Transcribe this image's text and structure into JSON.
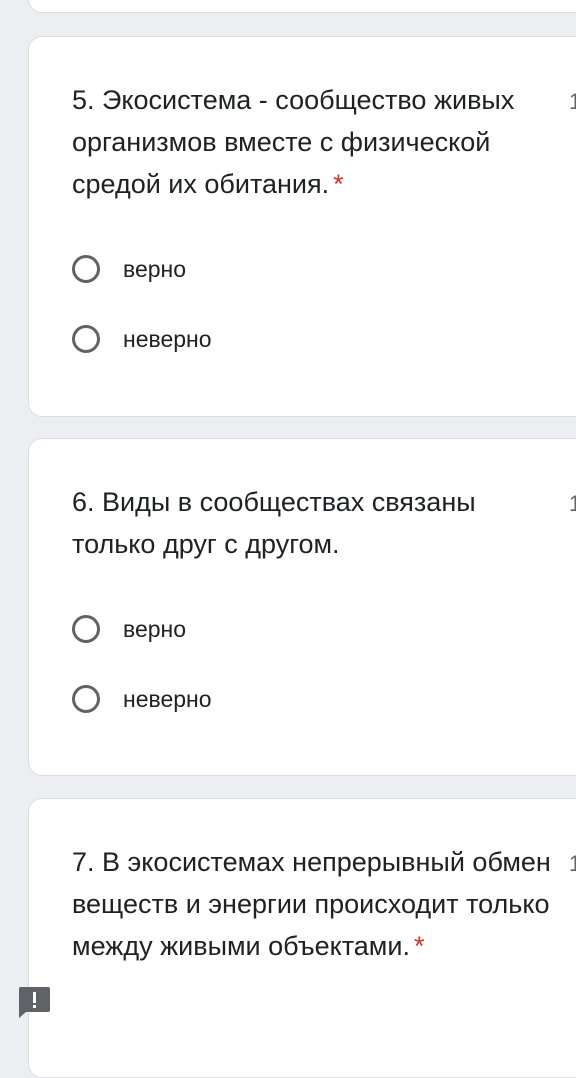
{
  "questions": [
    {
      "title": "5. Экосистема - сообщество живых организмов вместе с физической средой их обитания.",
      "required_mark": "*",
      "points": "1",
      "options": [
        "верно",
        "неверно"
      ]
    },
    {
      "title": "6. Виды в сообществах связаны только друг с другом.",
      "points": "1",
      "options": [
        "верно",
        "неверно"
      ]
    },
    {
      "title": "7. В экосистемах непрерывный обмен веществ и энергии происходит только между живыми объектами.",
      "required_mark": "*",
      "points": "1"
    }
  ],
  "icons": {
    "report_button": "report-problem-icon"
  },
  "colors": {
    "background": "#eceef1",
    "card": "#ffffff",
    "required": "#d93025",
    "radio_border": "#5f6368",
    "text": "#202124",
    "report_icon": "#5f6368"
  }
}
